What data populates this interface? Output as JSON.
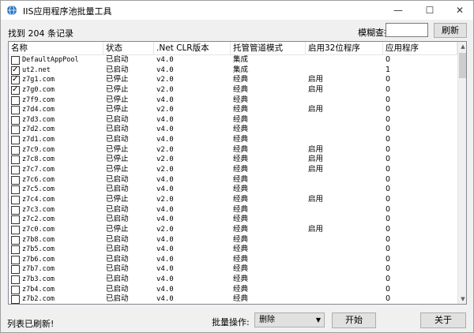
{
  "window": {
    "title": "IIS应用程序池批量工具",
    "minimize": "—",
    "maximize": "☐",
    "close": "✕"
  },
  "toolbar": {
    "record_count": "找到 204 条记录",
    "search_label": "模糊查找:",
    "search_value": "",
    "refresh_label": "刷新"
  },
  "table": {
    "columns": [
      "名称",
      "状态",
      ".Net CLR版本",
      "托管管道模式",
      "启用32位程序",
      "应用程序"
    ],
    "rows": [
      {
        "checked": false,
        "name": "DefaultAppPool",
        "status": "已启动",
        "version": "v4.0",
        "mode": "集成",
        "enable32": "",
        "apps": "0"
      },
      {
        "checked": true,
        "name": "ut2.net",
        "status": "已启动",
        "version": "v4.0",
        "mode": "集成",
        "enable32": "",
        "apps": "1"
      },
      {
        "checked": true,
        "name": "z7g1.com",
        "status": "已停止",
        "version": "v2.0",
        "mode": "经典",
        "enable32": "启用",
        "apps": "0"
      },
      {
        "checked": true,
        "name": "z7g0.com",
        "status": "已停止",
        "version": "v2.0",
        "mode": "经典",
        "enable32": "启用",
        "apps": "0"
      },
      {
        "checked": false,
        "name": "z7f9.com",
        "status": "已停止",
        "version": "v4.0",
        "mode": "经典",
        "enable32": "",
        "apps": "0"
      },
      {
        "checked": false,
        "name": "z7d4.com",
        "status": "已停止",
        "version": "v2.0",
        "mode": "经典",
        "enable32": "启用",
        "apps": "0"
      },
      {
        "checked": false,
        "name": "z7d3.com",
        "status": "已启动",
        "version": "v4.0",
        "mode": "经典",
        "enable32": "",
        "apps": "0"
      },
      {
        "checked": false,
        "name": "z7d2.com",
        "status": "已启动",
        "version": "v4.0",
        "mode": "经典",
        "enable32": "",
        "apps": "0"
      },
      {
        "checked": false,
        "name": "z7d1.com",
        "status": "已启动",
        "version": "v4.0",
        "mode": "经典",
        "enable32": "",
        "apps": "0"
      },
      {
        "checked": false,
        "name": "z7c9.com",
        "status": "已停止",
        "version": "v2.0",
        "mode": "经典",
        "enable32": "启用",
        "apps": "0"
      },
      {
        "checked": false,
        "name": "z7c8.com",
        "status": "已停止",
        "version": "v2.0",
        "mode": "经典",
        "enable32": "启用",
        "apps": "0"
      },
      {
        "checked": false,
        "name": "z7c7.com",
        "status": "已停止",
        "version": "v2.0",
        "mode": "经典",
        "enable32": "启用",
        "apps": "0"
      },
      {
        "checked": false,
        "name": "z7c6.com",
        "status": "已启动",
        "version": "v4.0",
        "mode": "经典",
        "enable32": "",
        "apps": "0"
      },
      {
        "checked": false,
        "name": "z7c5.com",
        "status": "已启动",
        "version": "v4.0",
        "mode": "经典",
        "enable32": "",
        "apps": "0"
      },
      {
        "checked": false,
        "name": "z7c4.com",
        "status": "已停止",
        "version": "v2.0",
        "mode": "经典",
        "enable32": "启用",
        "apps": "0"
      },
      {
        "checked": false,
        "name": "z7c3.com",
        "status": "已启动",
        "version": "v4.0",
        "mode": "经典",
        "enable32": "",
        "apps": "0"
      },
      {
        "checked": false,
        "name": "z7c2.com",
        "status": "已启动",
        "version": "v4.0",
        "mode": "经典",
        "enable32": "",
        "apps": "0"
      },
      {
        "checked": false,
        "name": "z7c0.com",
        "status": "已停止",
        "version": "v2.0",
        "mode": "经典",
        "enable32": "启用",
        "apps": "0"
      },
      {
        "checked": false,
        "name": "z7b8.com",
        "status": "已启动",
        "version": "v4.0",
        "mode": "经典",
        "enable32": "",
        "apps": "0"
      },
      {
        "checked": false,
        "name": "z7b5.com",
        "status": "已启动",
        "version": "v4.0",
        "mode": "经典",
        "enable32": "",
        "apps": "0"
      },
      {
        "checked": false,
        "name": "z7b6.com",
        "status": "已启动",
        "version": "v4.0",
        "mode": "经典",
        "enable32": "",
        "apps": "0"
      },
      {
        "checked": false,
        "name": "z7b7.com",
        "status": "已启动",
        "version": "v4.0",
        "mode": "经典",
        "enable32": "",
        "apps": "0"
      },
      {
        "checked": false,
        "name": "z7b3.com",
        "status": "已启动",
        "version": "v4.0",
        "mode": "经典",
        "enable32": "",
        "apps": "0"
      },
      {
        "checked": false,
        "name": "z7b4.com",
        "status": "已启动",
        "version": "v4.0",
        "mode": "经典",
        "enable32": "",
        "apps": "0"
      },
      {
        "checked": false,
        "name": "z7b2.com",
        "status": "已启动",
        "version": "v4.0",
        "mode": "经典",
        "enable32": "",
        "apps": "0"
      }
    ]
  },
  "footer": {
    "status_text": "列表已刷新!",
    "batch_label": "批量操作:",
    "batch_selected": "删除",
    "start_label": "开始",
    "about_label": "关于"
  }
}
